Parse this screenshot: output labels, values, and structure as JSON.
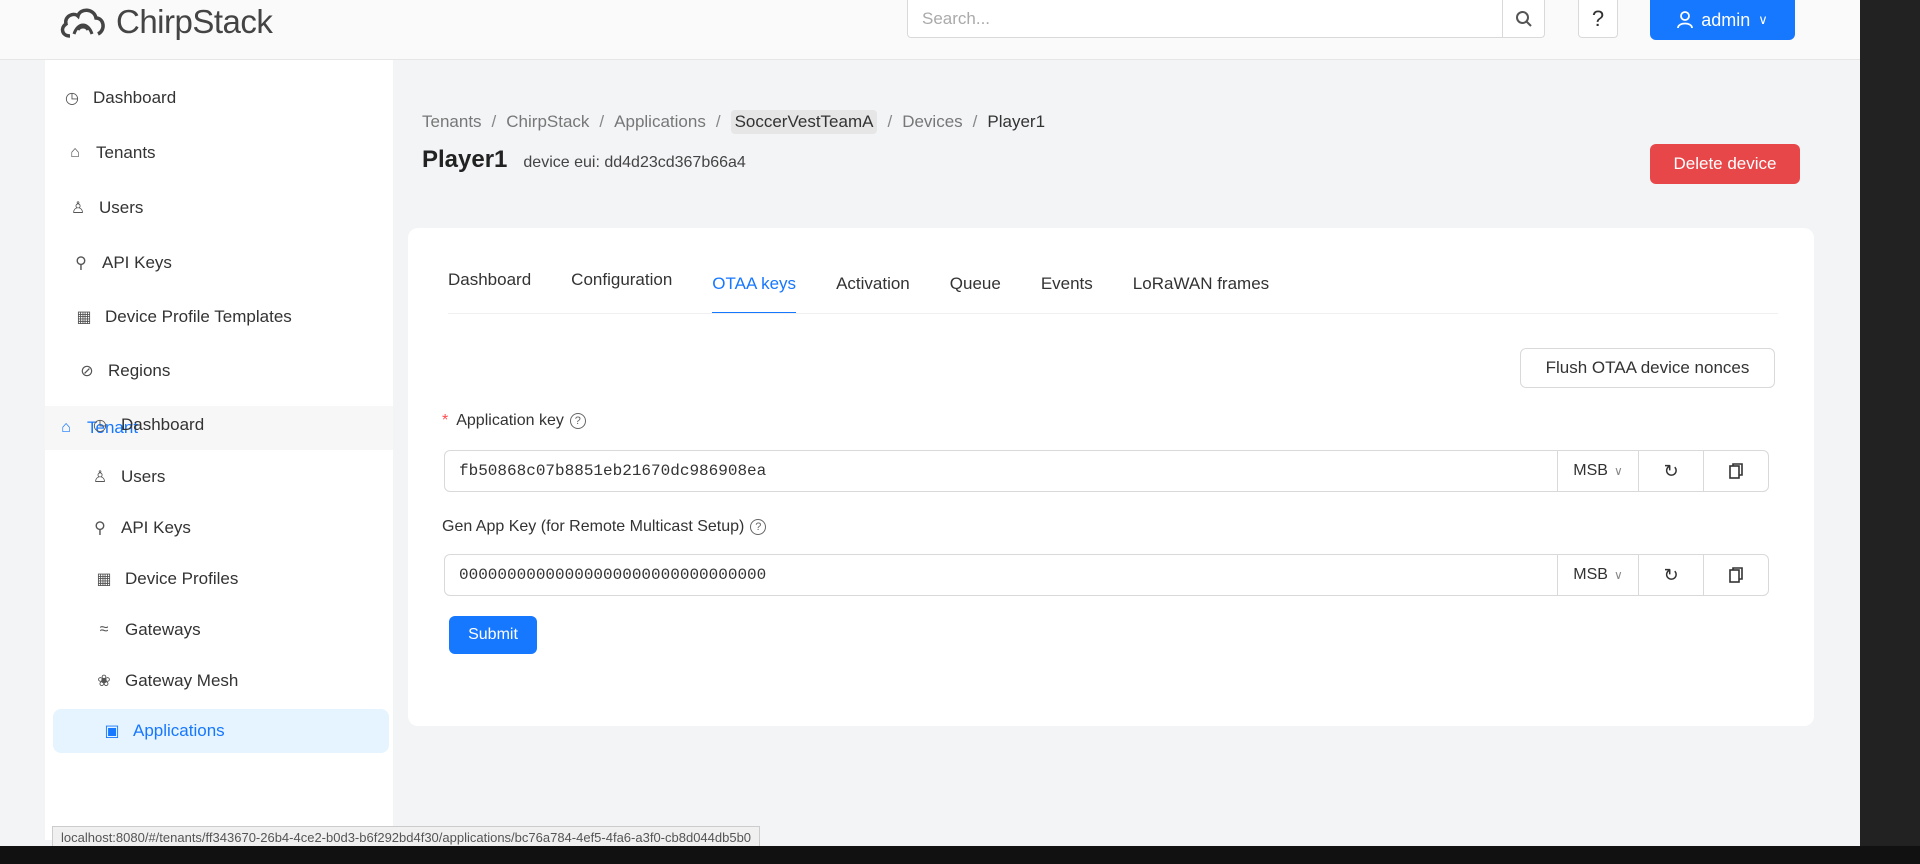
{
  "header": {
    "logo_text": "ChirpStack",
    "search_placeholder": "Search...",
    "help_label": "?",
    "user_label": "admin"
  },
  "sidebar": {
    "items": [
      {
        "label": "Dashboard",
        "icon": "dashboard-icon"
      },
      {
        "label": "Tenants",
        "icon": "home-icon"
      },
      {
        "label": "Users",
        "icon": "user-icon"
      },
      {
        "label": "API Keys",
        "icon": "key-icon"
      },
      {
        "label": "Device Profile Templates",
        "icon": "template-icon"
      },
      {
        "label": "Regions",
        "icon": "compass-icon"
      }
    ],
    "tenant_group": {
      "label": "Tenant",
      "icon": "home-icon"
    },
    "tenant_items": [
      {
        "label": "Dashboard",
        "icon": "dashboard-icon"
      },
      {
        "label": "Users",
        "icon": "user-icon"
      },
      {
        "label": "API Keys",
        "icon": "key-icon"
      },
      {
        "label": "Device Profiles",
        "icon": "template-icon"
      },
      {
        "label": "Gateways",
        "icon": "wifi-icon"
      },
      {
        "label": "Gateway Mesh",
        "icon": "mesh-icon"
      },
      {
        "label": "Applications",
        "icon": "apps-icon",
        "active": true
      }
    ]
  },
  "breadcrumb": [
    "Tenants",
    "ChirpStack",
    "Applications",
    "SoccerVestTeamA",
    "Devices",
    "Player1"
  ],
  "page": {
    "title": "Player1",
    "device_eui": "device eui: dd4d23cd367b66a4",
    "delete_label": "Delete device"
  },
  "tabs": [
    {
      "label": "Dashboard"
    },
    {
      "label": "Configuration"
    },
    {
      "label": "OTAA keys",
      "active": true
    },
    {
      "label": "Activation"
    },
    {
      "label": "Queue"
    },
    {
      "label": "Events"
    },
    {
      "label": "LoRaWAN frames"
    }
  ],
  "form": {
    "flush_label": "Flush OTAA device nonces",
    "app_key_label": "Application key",
    "app_key_value": "fb50868c07b8851eb21670dc986908ea",
    "gen_app_key_label": "Gen App Key (for Remote Multicast Setup)",
    "gen_app_key_value": "00000000000000000000000000000000",
    "byte_order": "MSB",
    "submit_label": "Submit"
  },
  "status_bar": "localhost:8080/#/tenants/ff343670-26b4-4ce2-b0d3-b6f292bd4f30/applications/bc76a784-4ef5-4fa6-a3f0-cb8d044db5b0"
}
